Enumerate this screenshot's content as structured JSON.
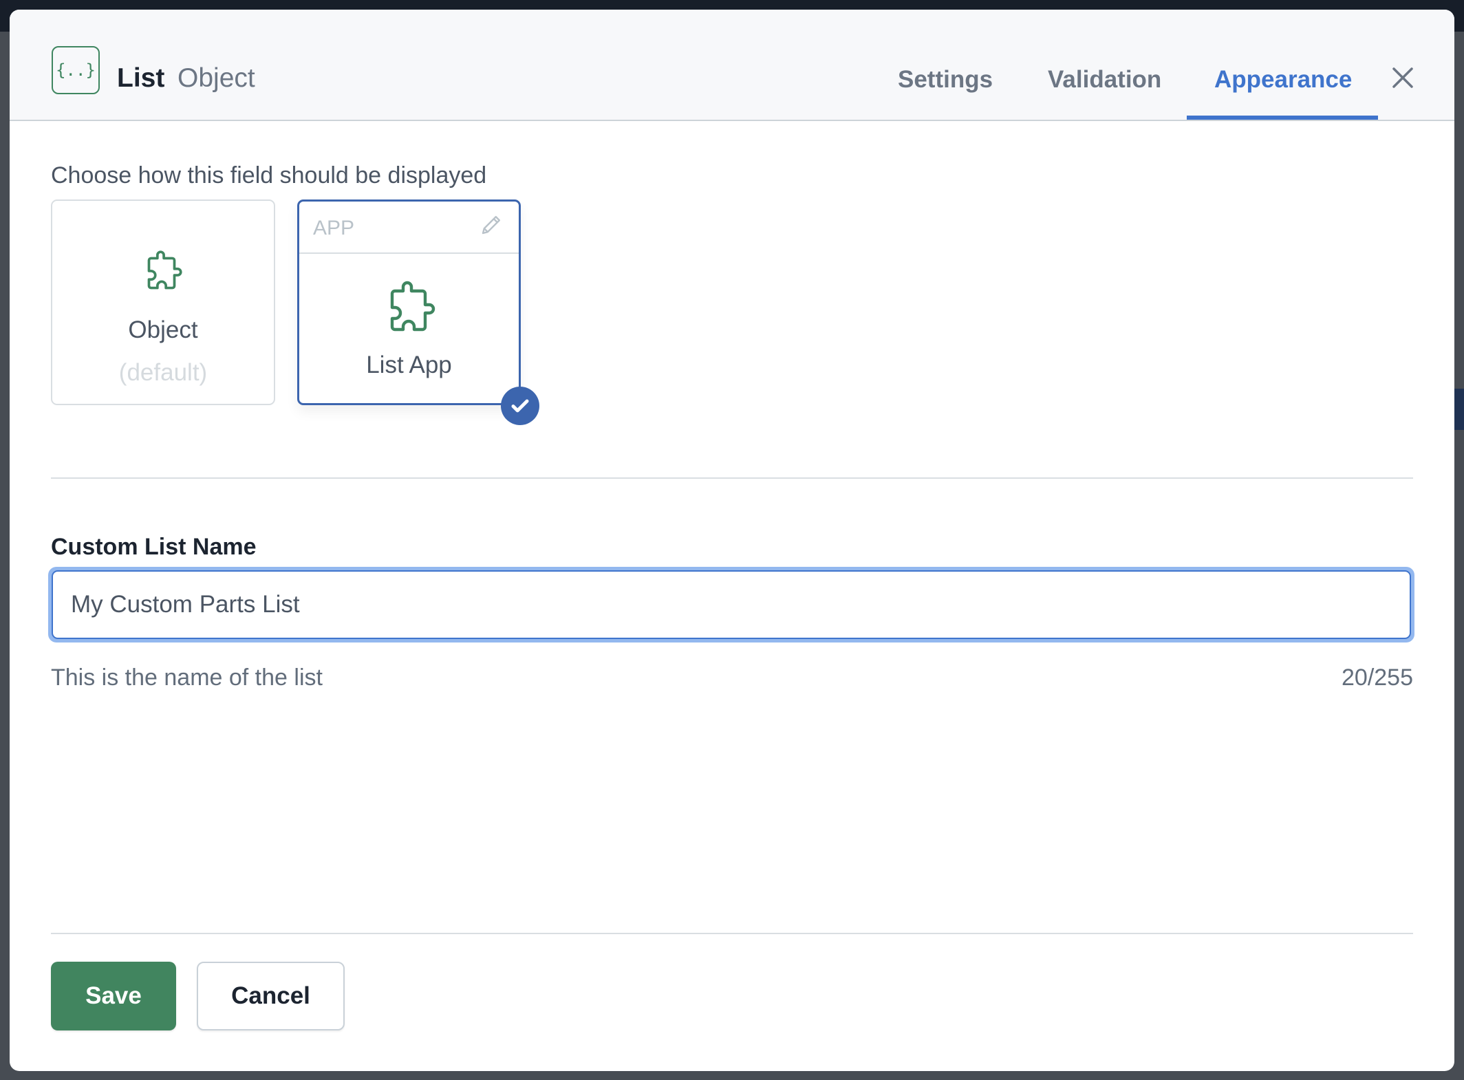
{
  "header": {
    "type_icon": "curly-braces-icon",
    "type_icon_text": "{..}",
    "title": "List",
    "subtitle": "Object",
    "tabs": [
      {
        "label": "Settings",
        "active": false
      },
      {
        "label": "Validation",
        "active": false
      },
      {
        "label": "Appearance",
        "active": true
      }
    ],
    "close_icon": "close-icon"
  },
  "appearance": {
    "intro": "Choose how this field should be displayed",
    "options": [
      {
        "name": "Object",
        "sublabel": "(default)",
        "icon": "puzzle-icon",
        "selected": false
      },
      {
        "tag": "APP",
        "name": "List App",
        "icon": "puzzle-icon",
        "edit_icon": "pencil-icon",
        "selected": true
      }
    ]
  },
  "custom_name": {
    "label": "Custom List Name",
    "value": "My Custom Parts List",
    "help": "This is the name of the list",
    "counter": "20/255"
  },
  "footer": {
    "save_label": "Save",
    "cancel_label": "Cancel"
  },
  "colors": {
    "accent_blue": "#3f74cc",
    "selected_border": "#3c65ae",
    "brand_green": "#41855f",
    "focus_ring": "#93b8ef"
  }
}
